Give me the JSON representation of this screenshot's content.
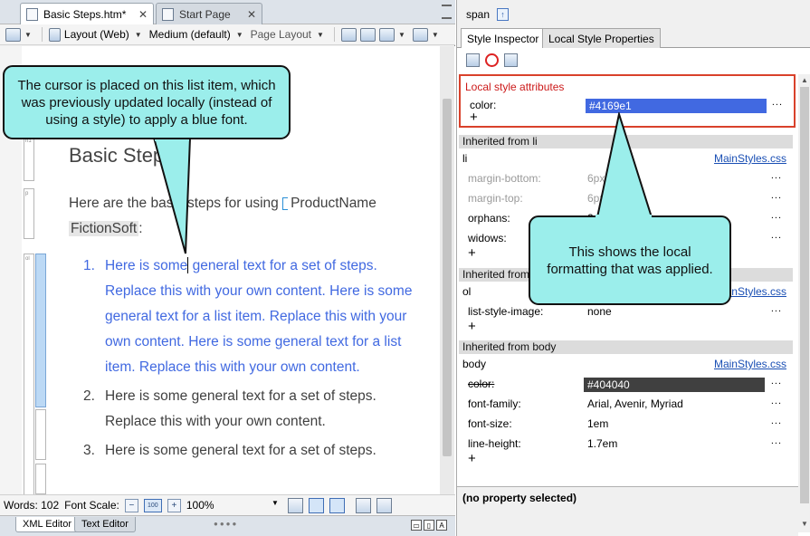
{
  "editor": {
    "tabs": [
      {
        "label": "Basic Steps.htm*",
        "close": "✕"
      },
      {
        "label": "Start Page",
        "close": "✕"
      }
    ],
    "toolbar": {
      "layout": "Layout (Web)",
      "medium": "Medium (default)",
      "page_layout": "Page Layout"
    },
    "structure_tags": {
      "h1": "h1",
      "p": "p",
      "ol": "ol"
    },
    "document": {
      "heading": "Basic Steps",
      "intro_before": "Here are the basic steps for using",
      "intro_variable": "ProductName",
      "intro_line2": "FictionSoft",
      "intro_after": ":",
      "list": [
        {
          "num": "1.",
          "pre": "Here is some",
          "post": " general text for a set of steps. Replace this with your own content. Here is some general text for a list item. Replace this with your own content. Here is some general text for a list item. Replace this with your own content."
        },
        {
          "num": "2.",
          "text": "Here is some general text for a set of steps. Replace this with your own content."
        },
        {
          "num": "3.",
          "text": "Here is some general text for a set of steps."
        }
      ]
    },
    "status": {
      "words_label": "Words: 102",
      "font_scale_label": "Font Scale:",
      "zoom_minus": "−",
      "zoom_reset": "100",
      "zoom_plus": "+",
      "zoom_value": "100%"
    },
    "bottom_tabs": [
      "XML Editor",
      "Text Editor"
    ],
    "view_buttons": [
      "▭",
      "▯",
      "A"
    ]
  },
  "inspector": {
    "element": "span",
    "tabs": [
      "Style Inspector",
      "Local Style Properties"
    ],
    "local": {
      "title": "Local style attributes",
      "props": [
        {
          "name": "color:",
          "value": "#4169e1",
          "swatch": "#4169e1"
        }
      ]
    },
    "inherited": [
      {
        "title": "Inherited from li",
        "selector": "li",
        "source": "MainStyles.css",
        "props": [
          {
            "name": "margin-bottom:",
            "value": "6px",
            "inherited": true
          },
          {
            "name": "margin-top:",
            "value": "6px",
            "inherited": true
          },
          {
            "name": "orphans:",
            "value": "2",
            "inherited": false
          },
          {
            "name": "widows:",
            "value": "",
            "inherited": false
          }
        ]
      },
      {
        "title": "Inherited from ol",
        "selector": "ol",
        "source": "MainStyles.css",
        "props": [
          {
            "name": "list-style-image:",
            "value": "none",
            "inherited": false
          }
        ]
      },
      {
        "title": "Inherited from body",
        "selector": "body",
        "source": "MainStyles.css",
        "props": [
          {
            "name": "color:",
            "value": "#404040",
            "swatch": "#404040",
            "struck": true
          },
          {
            "name": "font-family:",
            "value": "Arial, Avenir, Myriad",
            "inherited": false
          },
          {
            "name": "font-size:",
            "value": "1em",
            "inherited": false
          },
          {
            "name": "line-height:",
            "value": "1.7em",
            "inherited": false
          }
        ]
      }
    ],
    "more_button": "...",
    "add_button": "+",
    "description": "(no property selected)"
  },
  "callouts": {
    "cursor_note": "The cursor is placed on this list item, which was previously updated locally (instead of using a style) to apply a blue font.",
    "local_note": "This shows the local formatting that was applied."
  },
  "colors": {
    "local_blue": "#4169e1",
    "body_gray": "#404040",
    "callout_fill": "#9beeeb",
    "highlight_border": "#d9412b"
  }
}
